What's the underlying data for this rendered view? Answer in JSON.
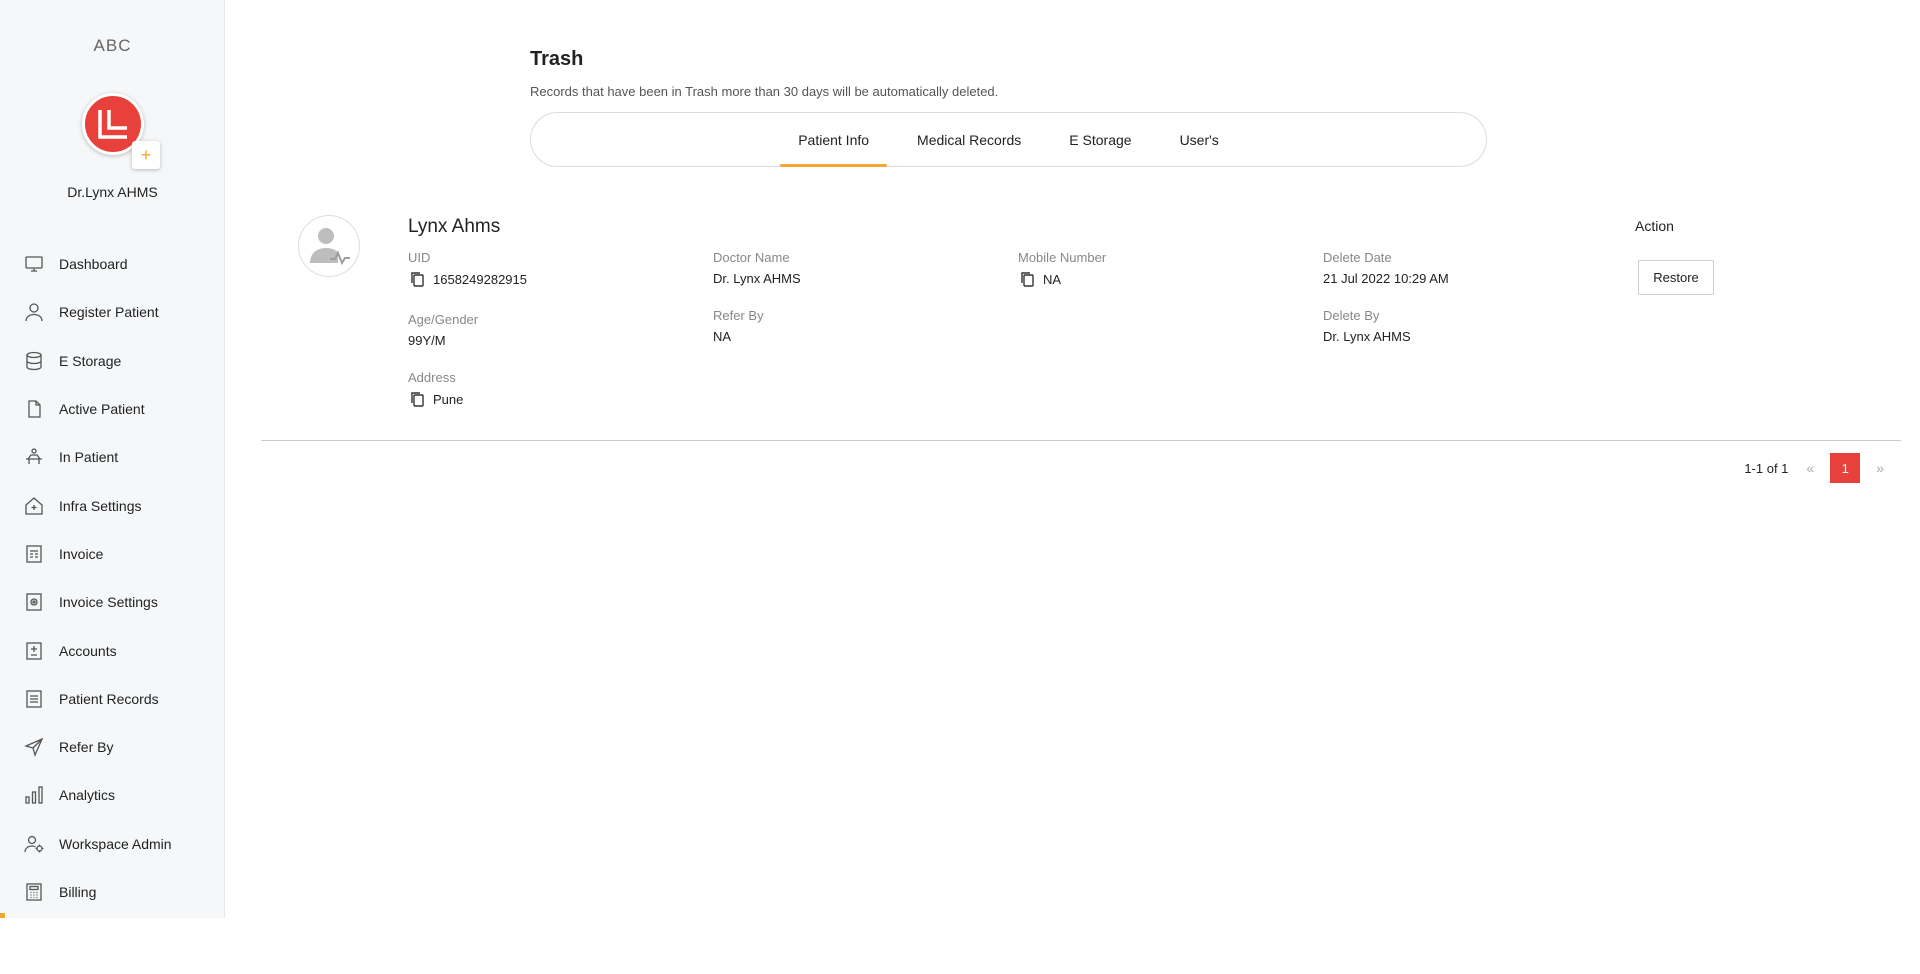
{
  "sidebar": {
    "org_name": "ABC",
    "user_name": "Dr.Lynx AHMS",
    "add_symbol": "+",
    "items": [
      {
        "label": "Dashboard",
        "icon": "monitor-icon"
      },
      {
        "label": "Register Patient",
        "icon": "user-icon"
      },
      {
        "label": "E Storage",
        "icon": "database-icon"
      },
      {
        "label": "Active Patient",
        "icon": "file-icon"
      },
      {
        "label": "In Patient",
        "icon": "bed-icon"
      },
      {
        "label": "Infra Settings",
        "icon": "home-plus-icon"
      },
      {
        "label": "Invoice",
        "icon": "invoice-icon"
      },
      {
        "label": "Invoice Settings",
        "icon": "invoice-settings-icon"
      },
      {
        "label": "Accounts",
        "icon": "accounts-icon"
      },
      {
        "label": "Patient Records",
        "icon": "list-icon"
      },
      {
        "label": "Refer By",
        "icon": "send-icon"
      },
      {
        "label": "Analytics",
        "icon": "bar-chart-icon"
      },
      {
        "label": "Workspace Admin",
        "icon": "admin-icon"
      },
      {
        "label": "Billing",
        "icon": "calculator-icon"
      }
    ]
  },
  "page": {
    "title": "Trash",
    "subtitle": "Records that have been in Trash more than 30 days will be automatically deleted."
  },
  "tabs": [
    {
      "label": "Patient Info",
      "active": true
    },
    {
      "label": "Medical Records",
      "active": false
    },
    {
      "label": "E Storage",
      "active": false
    },
    {
      "label": "User's",
      "active": false
    }
  ],
  "record": {
    "name": "Lynx Ahms",
    "uid_label": "UID",
    "uid": "1658249282915",
    "doctor_label": "Doctor Name",
    "doctor": "Dr. Lynx AHMS",
    "mobile_label": "Mobile Number",
    "mobile": "NA",
    "delete_date_label": "Delete Date",
    "delete_date": "21 Jul 2022 10:29 AM",
    "age_label": "Age/Gender",
    "age": "99Y/M",
    "refer_label": "Refer By",
    "refer": "NA",
    "delete_by_label": "Delete By",
    "delete_by": "Dr. Lynx AHMS",
    "address_label": "Address",
    "address": "Pune",
    "action_label": "Action",
    "restore_label": "Restore"
  },
  "pagination": {
    "range": "1-1 of 1",
    "prev": "«",
    "current": "1",
    "next": "»"
  },
  "colors": {
    "brand": "#e8413b",
    "accent": "#f2a634"
  }
}
